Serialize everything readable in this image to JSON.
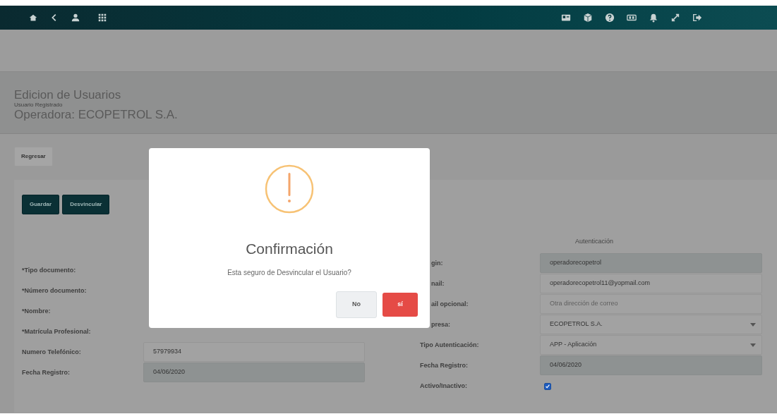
{
  "header": {
    "title": "Edicion de Usuarios",
    "subtitle": "Usuario Registrado",
    "operator": "Operadora: ECOPETROL S.A."
  },
  "back_button": "Regresar",
  "actions": [
    "Guardar",
    "Desvincular"
  ],
  "left_fields": [
    {
      "label": "*Tipo documento:"
    },
    {
      "label": "*Número documento:"
    },
    {
      "label": "*Nombre:"
    },
    {
      "label": "*Matrícula Profesional:"
    },
    {
      "label": "Numero Telefónico:",
      "kind": "input",
      "value": "57979934"
    },
    {
      "label": "Fecha Registro:",
      "kind": "readonly",
      "value": "04/06/2020"
    }
  ],
  "right_section": {
    "title": "Autenticación",
    "fields": [
      {
        "label": "gin:",
        "cut": true,
        "kind": "readonly",
        "value": "operadorecopetrol"
      },
      {
        "label": "nail:",
        "cut": true,
        "kind": "input",
        "value": "operadorecopetrol11@yopmail.com"
      },
      {
        "label": "ail opcional:",
        "cut": true,
        "kind": "input",
        "placeholder": "Otra dirección de correo"
      },
      {
        "label": "presa:",
        "cut": true,
        "kind": "select",
        "value": "ECOPETROL S.A."
      },
      {
        "label": "Tipo Autenticación:",
        "cut": false,
        "kind": "select",
        "value": "APP - Aplicación"
      },
      {
        "label": "Fecha Registro:",
        "cut": false,
        "kind": "readonly",
        "value": "04/06/2020"
      },
      {
        "label": "Activo/Inactivo:",
        "cut": false,
        "kind": "checkbox",
        "checked": true
      }
    ]
  },
  "dialog": {
    "title": "Confirmación",
    "message": "Esta seguro de Desvincular el Usuario?",
    "buttons": [
      {
        "label": "No",
        "kind": "secondary"
      },
      {
        "label": "sí",
        "kind": "danger"
      }
    ]
  }
}
